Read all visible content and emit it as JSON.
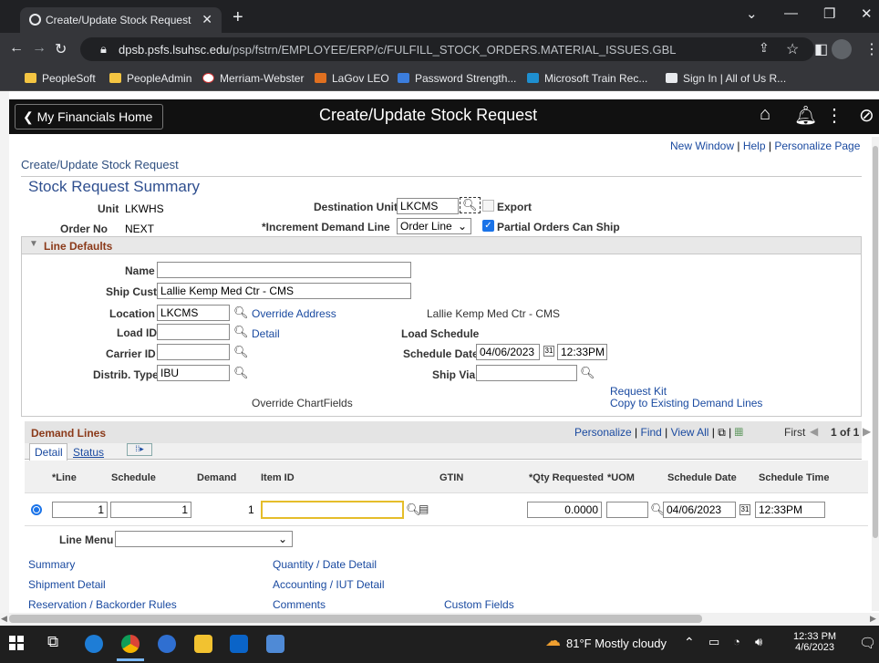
{
  "browser": {
    "tab_title": "Create/Update Stock Request",
    "url_domain": "dpsb.psfs.lsuhsc.edu",
    "url_path": "/psp/fstrn/EMPLOYEE/ERP/c/FULFILL_STOCK_ORDERS.MATERIAL_ISSUES.GBL",
    "bookmarks": [
      "PeopleSoft",
      "PeopleAdmin",
      "Merriam-Webster",
      "LaGov LEO",
      "Password Strength...",
      "Microsoft Train Rec...",
      "Sign In | All of Us R..."
    ]
  },
  "header": {
    "home": "My Financials Home",
    "title": "Create/Update Stock Request"
  },
  "toplinks": {
    "new_window": "New Window",
    "help": "Help",
    "personalize": "Personalize Page"
  },
  "breadcrumb": "Create/Update Stock Request",
  "summary": {
    "title": "Stock Request Summary",
    "unit_label": "Unit",
    "unit_value": "LKWHS",
    "order_label": "Order No",
    "order_value": "NEXT",
    "dest_label": "Destination Unit",
    "dest_value": "LKCMS",
    "export_label": "Export",
    "incr_label": "*Increment Demand Line",
    "incr_value": "Order Line",
    "partial_label": "Partial Orders Can Ship"
  },
  "line_defaults": {
    "title": "Line Defaults",
    "name_label": "Name",
    "name_value": "",
    "shipcust_label": "Ship Cust",
    "shipcust_value": "Lallie Kemp Med Ctr - CMS",
    "location_label": "Location",
    "location_value": "LKCMS",
    "override_address": "Override Address",
    "location_desc": "Lallie Kemp Med Ctr - CMS",
    "loadid_label": "Load ID",
    "detail_link": "Detail",
    "load_schedule": "Load Schedule",
    "carrier_label": "Carrier ID",
    "sched_date_label": "Schedule Date",
    "sched_date_value": "04/06/2023",
    "sched_time_value": "12:33PM",
    "distrib_label": "Distrib. Type",
    "distrib_value": "IBU",
    "shipvia_label": "Ship Via",
    "request_kit": "Request Kit",
    "copy_existing": "Copy to Existing Demand Lines",
    "override_chartfields": "Override ChartFields"
  },
  "demand_lines": {
    "title": "Demand Lines",
    "nav": {
      "personalize": "Personalize",
      "find": "Find",
      "view_all": "View All",
      "first": "First",
      "count": "1 of 1"
    },
    "tabs": [
      "Detail",
      "Status"
    ],
    "columns": [
      "*Line",
      "Schedule",
      "Demand",
      "Item ID",
      "GTIN",
      "*Qty Requested",
      "*UOM",
      "Schedule Date",
      "Schedule Time"
    ],
    "row": {
      "line": "1",
      "schedule": "1",
      "demand": "1",
      "item": "",
      "qty": "0.0000",
      "uom": "",
      "date": "04/06/2023",
      "time": "12:33PM"
    },
    "line_menu_label": "Line Menu"
  },
  "links": {
    "summary": "Summary",
    "shipment": "Shipment Detail",
    "reservation": "Reservation / Backorder Rules",
    "qty_date": "Quantity / Date Detail",
    "accounting": "Accounting / IUT Detail",
    "comments": "Comments",
    "custom": "Custom Fields"
  },
  "taskbar": {
    "weather": "81°F  Mostly cloudy",
    "time": "12:33 PM",
    "date": "4/6/2023"
  }
}
